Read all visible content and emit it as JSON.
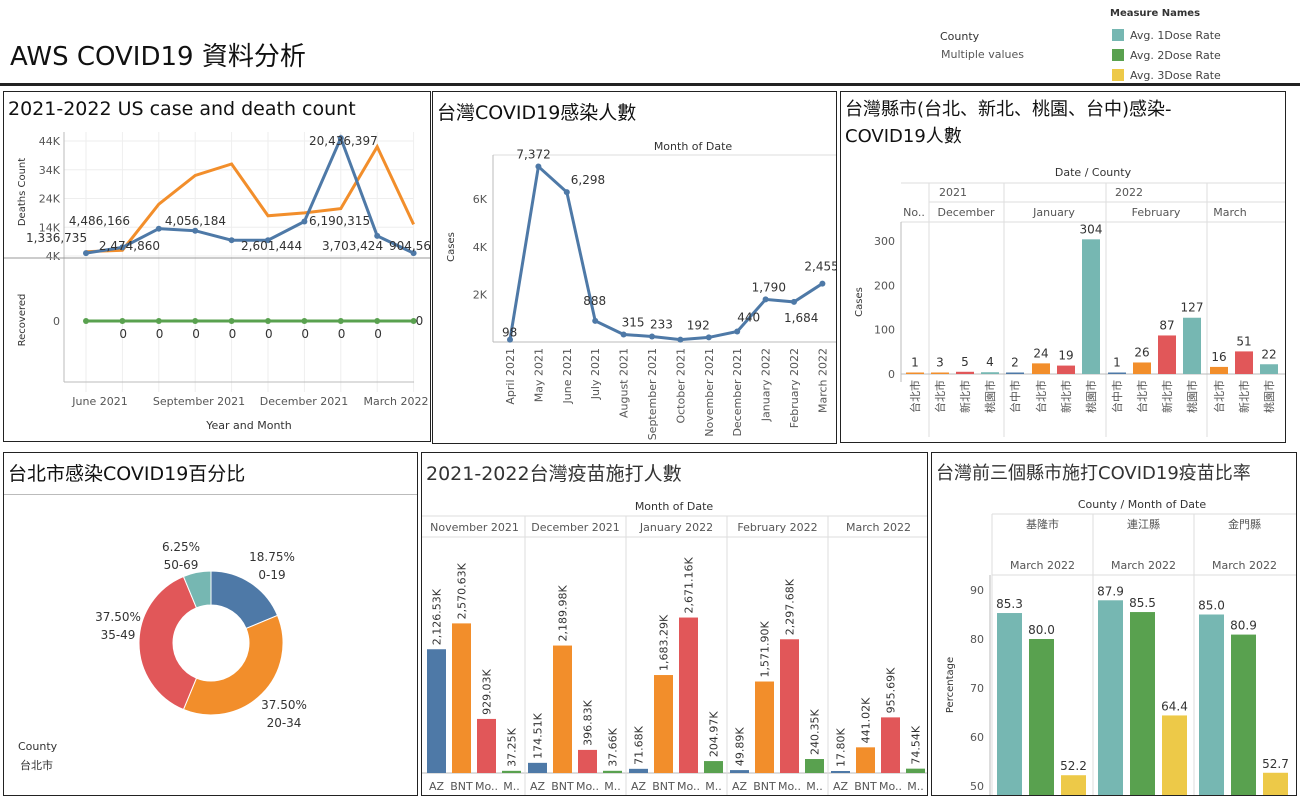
{
  "header": {
    "title": "AWS COVID19 資料分析",
    "filter_label": "County",
    "filter_value": "Multiple values",
    "legend_title": "Measure Names",
    "legend": [
      {
        "label": "Avg. 1Dose Rate",
        "color": "#76b7b2"
      },
      {
        "label": "Avg. 2Dose Rate",
        "color": "#59a14f"
      },
      {
        "label": "Avg. 3Dose Rate",
        "color": "#edc948"
      }
    ]
  },
  "colors": {
    "blue": "#4e79a7",
    "orange": "#f28e2b",
    "red": "#e15759",
    "teal": "#76b7b2",
    "green": "#59a14f",
    "yellow": "#edc948"
  },
  "panels": {
    "us": {
      "title": "2021-2022 US case and death count"
    },
    "tw": {
      "title": "台灣COVID19感染人數"
    },
    "city": {
      "title_line1": "台灣縣市(台北、新北、桃園、台中)感染-",
      "title_line2": "COVID19人數"
    },
    "taipei": {
      "title": "台北市感染COVID19百分比",
      "filter_label": "County",
      "filter_value": "台北市"
    },
    "vacc": {
      "title": "2021-2022台灣疫苗施打人數"
    },
    "top3": {
      "title": "台灣前三個縣市施打COVID19疫苗比率"
    }
  },
  "chart_data": [
    {
      "id": "us",
      "type": "line",
      "xlabel": "Year and Month",
      "x_tick_labels": [
        "June 2021",
        "September 2021",
        "December 2021",
        "March 2022"
      ],
      "top": {
        "ylabel": "Deaths Count",
        "yticks": [
          "44K",
          "34K",
          "24K",
          "14K",
          "4K"
        ],
        "series": [
          {
            "color": "#f28e2b",
            "values": [
              5500,
              6000,
              22000,
              32000,
              36000,
              18000,
              19000,
              20500,
              42000,
              15000
            ]
          },
          {
            "color": "#4e79a7",
            "values": [
              5000,
              7000,
              13500,
              12800,
              9500,
              9500,
              16000,
              45000,
              11000,
              5000
            ]
          }
        ],
        "data_labels": [
          "1,336,735",
          "4,486,166",
          "4,056,184",
          "2,474,860",
          "2,601,444",
          "6,190,315",
          "20,436,397",
          "3,703,424",
          "904,562"
        ]
      },
      "bottom": {
        "ylabel": "Recovered",
        "ytick": "0",
        "series": [
          {
            "color": "#59a14f",
            "values": [
              0,
              0,
              0,
              0,
              0,
              0,
              0,
              0,
              0,
              0
            ]
          }
        ],
        "data_labels": [
          "0",
          "0",
          "0",
          "0",
          "0",
          "0",
          "0",
          "0",
          "0",
          "0"
        ]
      }
    },
    {
      "id": "tw",
      "type": "line",
      "header": "Month of Date",
      "ylabel": "Cases",
      "yticks": [
        "6K",
        "4K",
        "2K"
      ],
      "categories": [
        "April 2021",
        "May 2021",
        "June 2021",
        "July 2021",
        "August 2021",
        "September 2021",
        "October 2021",
        "November 2021",
        "December 2021",
        "January 2022",
        "February 2022",
        "March 2022"
      ],
      "values": [
        98,
        7372,
        6298,
        888,
        315,
        233,
        100,
        192,
        440,
        1790,
        1684,
        2455
      ],
      "data_labels": [
        "98",
        "7,372",
        "6,298",
        "888",
        "315",
        "233",
        "",
        "192",
        "440",
        "1,790",
        "1,684",
        "2,455"
      ],
      "ylim": [
        0,
        8000
      ]
    },
    {
      "id": "city",
      "type": "bar",
      "header": "Date / County",
      "ylabel": "Cases",
      "yticks": [
        "300",
        "200",
        "100",
        "0"
      ],
      "year_labels": [
        "2021",
        "2022"
      ],
      "month_labels": [
        "No..",
        "December",
        "January",
        "February",
        "March"
      ],
      "categories": [
        "台北市",
        "台北市",
        "新北市",
        "桃園市",
        "台中市",
        "台北市",
        "新北市",
        "桃園市",
        "台中市",
        "台北市",
        "新北市",
        "桃園市",
        "台北市",
        "新北市",
        "桃園市"
      ],
      "values": [
        1,
        3,
        5,
        4,
        2,
        24,
        19,
        304,
        1,
        26,
        87,
        127,
        16,
        51,
        22
      ],
      "data_labels": [
        "1",
        "3",
        "5",
        "4",
        "2",
        "24",
        "19",
        "304",
        "1",
        "26",
        "87",
        "127",
        "16",
        "51",
        "22"
      ],
      "ylim": [
        0,
        340
      ]
    },
    {
      "id": "taipei",
      "type": "pie",
      "slices": [
        {
          "pct_label": "18.75%",
          "group": "0-19",
          "value": 18.75,
          "color": "#4e79a7"
        },
        {
          "pct_label": "37.50%",
          "group": "20-34",
          "value": 37.5,
          "color": "#f28e2b"
        },
        {
          "pct_label": "37.50%",
          "group": "35-49",
          "value": 37.5,
          "color": "#e15759"
        },
        {
          "pct_label": "6.25%",
          "group": "50-69",
          "value": 6.25,
          "color": "#76b7b2"
        }
      ]
    },
    {
      "id": "vacc",
      "type": "bar",
      "header": "Month of Date",
      "months": [
        "November 2021",
        "December 2021",
        "January 2022",
        "February 2022",
        "March 2022"
      ],
      "x_labels": [
        "AZ",
        "BNT",
        "Mo..",
        "M.."
      ],
      "series_colors": [
        "#4e79a7",
        "#f28e2b",
        "#e15759",
        "#59a14f"
      ],
      "values": [
        [
          2126.53,
          2570.63,
          929.03,
          37.25
        ],
        [
          174.51,
          2189.98,
          396.83,
          37.66
        ],
        [
          71.68,
          1683.29,
          2671.16,
          204.97
        ],
        [
          49.89,
          1571.9,
          2297.68,
          240.35
        ],
        [
          17.8,
          441.02,
          955.69,
          74.54
        ]
      ],
      "data_labels": [
        [
          "2,126.53K",
          "2,570.63K",
          "929.03K",
          "37.25K"
        ],
        [
          "174.51K",
          "2,189.98K",
          "396.83K",
          "37.66K"
        ],
        [
          "71.68K",
          "1,683.29K",
          "2,671.16K",
          "204.97K"
        ],
        [
          "49.89K",
          "1,571.90K",
          "2,297.68K",
          "240.35K"
        ],
        [
          "17.80K",
          "441.02K",
          "955.69K",
          "74.54K"
        ]
      ]
    },
    {
      "id": "top3",
      "type": "bar",
      "header": "County / Month of Date",
      "ylabel": "Percentage",
      "yticks": [
        "90",
        "80",
        "70",
        "60",
        "50"
      ],
      "counties": [
        "基隆市",
        "連江縣",
        "金門縣"
      ],
      "month": "March 2022",
      "series_colors": [
        "#76b7b2",
        "#59a14f",
        "#edc948"
      ],
      "values": [
        [
          85.3,
          80.0,
          52.2
        ],
        [
          87.9,
          85.5,
          64.4
        ],
        [
          85.0,
          80.9,
          52.7
        ]
      ],
      "data_labels": [
        [
          "85.3",
          "80.0",
          "52.2"
        ],
        [
          "87.9",
          "85.5",
          "64.4"
        ],
        [
          "85.0",
          "80.9",
          "52.7"
        ]
      ],
      "ylim": [
        48,
        95
      ]
    }
  ]
}
